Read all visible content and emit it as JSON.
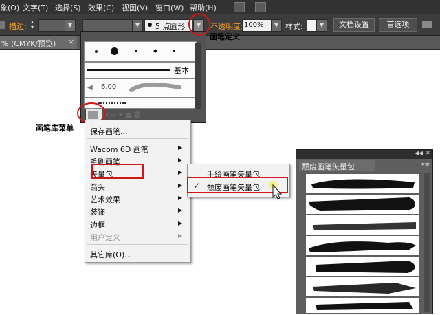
{
  "menubar": {
    "items": [
      "象(O)",
      "文字(T)",
      "选择(S)",
      "效果(C)",
      "视图(V)",
      "窗口(W)",
      "帮助(H)"
    ]
  },
  "controlbar": {
    "stroke_label": "描边:",
    "brush_value": "5 点圆形",
    "opacity_label": "不透明度:",
    "opacity_value": "100%",
    "style_label": "样式:",
    "doc_settings": "文档设置",
    "preferences": "首选项"
  },
  "doctab": {
    "label": "% (CMYK/预览)",
    "close": "×"
  },
  "brush_panel": {
    "basic_label": "基本",
    "size_value": "6.00"
  },
  "context_menu": {
    "items": [
      {
        "label": "保存画笔...",
        "submenu": false,
        "disabled": false
      },
      {
        "label": "Wacom 6D 画笔",
        "submenu": true,
        "disabled": false
      },
      {
        "label": "毛刷画笔",
        "submenu": true,
        "disabled": false
      },
      {
        "label": "矢量包",
        "submenu": true,
        "disabled": false
      },
      {
        "label": "箭头",
        "submenu": true,
        "disabled": false
      },
      {
        "label": "艺术效果",
        "submenu": true,
        "disabled": false
      },
      {
        "label": "装饰",
        "submenu": true,
        "disabled": false
      },
      {
        "label": "边框",
        "submenu": true,
        "disabled": false
      },
      {
        "label": "用户定义",
        "submenu": true,
        "disabled": true
      },
      {
        "label": "其它库(O)...",
        "submenu": false,
        "disabled": false
      }
    ]
  },
  "submenu": {
    "items": [
      "手绘画笔矢量包",
      "颓废画笔矢量包"
    ],
    "checked_index": 1,
    "check": "✓"
  },
  "vector_panel": {
    "title": "颓废画笔矢量包"
  },
  "annotations": {
    "brush_definition": "画笔定义",
    "brush_library_menu": "画笔库菜单"
  },
  "colors": {
    "highlight": "#d21515",
    "menubar": "#323232",
    "toolbar": "#3c3c3c",
    "accent_label": "#ffa531"
  }
}
